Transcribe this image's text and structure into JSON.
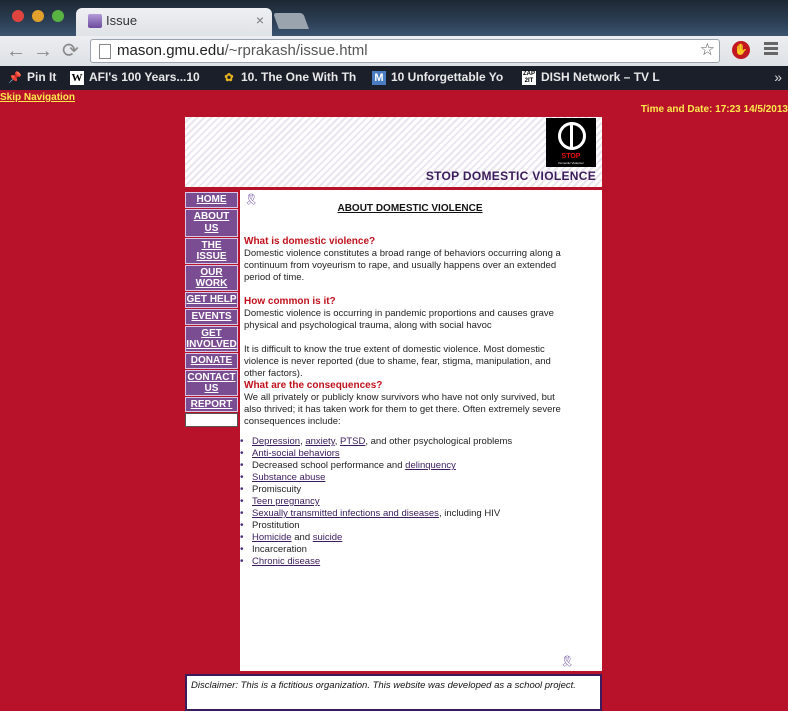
{
  "browser": {
    "tab_title": "Issue",
    "tab_close": "×",
    "back": "←",
    "forward": "→",
    "reload": "⟳",
    "url_host": "mason.gmu.edu",
    "url_path": "/~rprakash/issue.html",
    "star": "☆",
    "bookmarks": [
      {
        "icon": "pin-icon",
        "label": "Pin It"
      },
      {
        "icon": "wikipedia-icon",
        "label": "AFI's 100 Years...10"
      },
      {
        "icon": "leaf-icon",
        "label": "10. The One With Th"
      },
      {
        "icon": "m-icon",
        "label": "10 Unforgettable Yo"
      },
      {
        "icon": "zap2it-icon",
        "label": "DISH Network – TV L"
      }
    ],
    "bookmarks_more": "»"
  },
  "page": {
    "skip_nav": "Skip Navigation",
    "datetime": "Time and Date: 17:23 14/5/2013",
    "logo_stop": "STOP",
    "logo_sub": "Domestic Violence!",
    "site_title": "STOP DOMESTIC VIOLENCE",
    "nav": [
      {
        "label": "HOME"
      },
      {
        "label": "ABOUT US"
      },
      {
        "label": "THE ISSUE"
      },
      {
        "label": "OUR WORK"
      },
      {
        "label": "GET HELP"
      },
      {
        "label": "EVENTS"
      },
      {
        "label": "GET INVOLVED"
      },
      {
        "label": "DONATE"
      },
      {
        "label": "CONTACT US"
      },
      {
        "label": "REPORT ABUSE"
      }
    ],
    "main_title": "ABOUT DOMESTIC VIOLENCE",
    "q1": "What is domestic violence?",
    "a1": "Domestic violence constitutes a broad range of behaviors occurring along a continuum from voyeurism to rape, and usually happens over an extended period of time.",
    "q2": "How common is it?",
    "a2a": "Domestic violence is occurring in pandemic proportions and causes grave physical and psychological trauma, along with social havoc",
    "a2b": "It is difficult to know the true extent of domestic violence. Most domestic violence is never reported (due to shame, fear, stigma, manipulation, and other factors).",
    "q3": "What are the consequences?",
    "a3": "We all privately or publicly know survivors who have not only survived, but also thrived; it has taken work for them to get there. Often extremely severe consequences include:",
    "consequences": {
      "c1_links": [
        "Depression",
        "anxiety",
        "PTSD"
      ],
      "c1_sep1": ", ",
      "c1_sep2": ", ",
      "c1_tail": ", and other psychological problems",
      "c2": "Anti-social behaviors",
      "c3_text": "Decreased school performance and ",
      "c3_link": "delinquency",
      "c4": "Substance abuse",
      "c5": "Promiscuity",
      "c6": "Teen pregnancy",
      "c7_link": "Sexually transmitted infections and diseases",
      "c7_tail": ", including HIV",
      "c8": "Prostitution",
      "c9_link1": "Homicide",
      "c9_mid": " and ",
      "c9_link2": "suicide",
      "c10": "Incarceration",
      "c11": "Chronic disease"
    },
    "disclaimer": "Disclaimer: This is a fictitious organization. This website was developed as a school project."
  },
  "colors": {
    "page_bg": "#b8122a",
    "nav_bg": "#7a4d93",
    "heading_red": "#c0101c",
    "title_purple": "#3b1b5c",
    "yellow": "#ffe94d"
  }
}
